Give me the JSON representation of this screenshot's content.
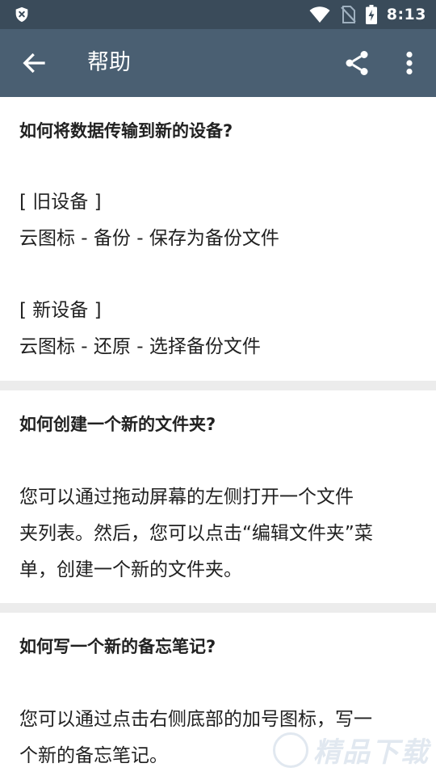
{
  "status_bar": {
    "time": "8:13",
    "left_icon": "shield-x-icon",
    "icons": [
      "wifi-icon",
      "no-sim-icon",
      "battery-charging-icon"
    ]
  },
  "app_bar": {
    "title": "帮助",
    "back_icon": "arrow-left-icon",
    "share_icon": "share-icon",
    "more_icon": "more-vertical-icon"
  },
  "cards": [
    {
      "title": "如何将数据传输到新的设备?",
      "lines": [
        "[ 旧设备 ]",
        "云图标 - 备份 - 保存为备份文件",
        "[ 新设备 ]",
        "云图标 - 还原 - 选择备份文件"
      ]
    },
    {
      "title": "如何创建一个新的文件夹?",
      "lines": [
        "您可以通过拖动屏幕的左侧打开一个文件",
        "夹列表。然后，您可以点击“编辑文件夹”菜",
        "单，创建一个新的文件夹。"
      ]
    },
    {
      "title": "如何写一个新的备忘笔记?",
      "lines": [
        "您可以通过点击右侧底部的加号图标，写一",
        "个新的备忘笔记。"
      ]
    }
  ],
  "watermark": {
    "text": "精品下载"
  },
  "colors": {
    "status_bar": "#3a4b5a",
    "app_bar": "#4a5f72",
    "divider": "#ececec",
    "text": "#212121"
  }
}
